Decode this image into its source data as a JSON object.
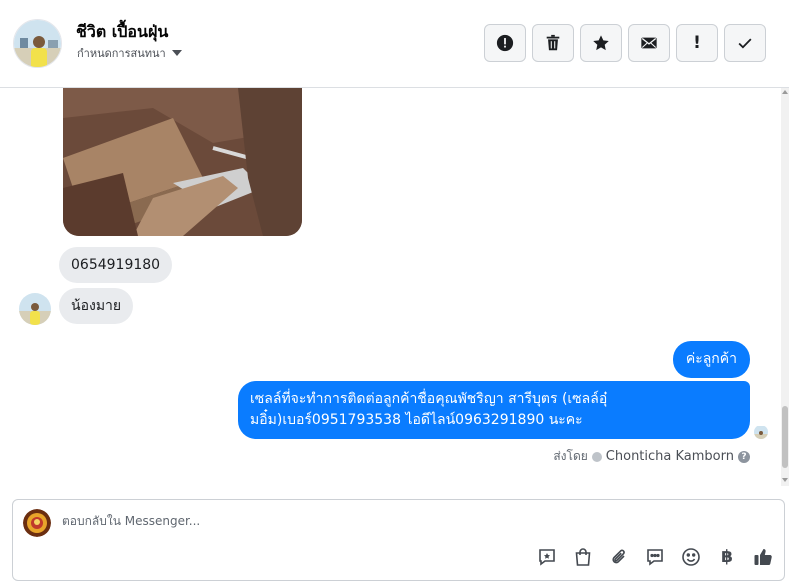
{
  "header": {
    "name": "ชีวิต เปื้อนฝุ่น",
    "assign_label": "กำหนดการสนทนา",
    "actions": [
      {
        "icon": "alert-circle-icon"
      },
      {
        "icon": "trash-icon"
      },
      {
        "icon": "star-icon"
      },
      {
        "icon": "envelope-icon"
      },
      {
        "icon": "exclamation-icon",
        "glyph": "!"
      },
      {
        "icon": "checkmark-icon"
      }
    ]
  },
  "messages": {
    "incoming": [
      {
        "text": "0654919180"
      },
      {
        "text": "น้องมาย"
      }
    ],
    "outgoing": [
      {
        "text": "ค่ะลูกค้า"
      },
      {
        "text": "เซลล์ที่จะทำการติดต่อลูกค้าชื่อคุณพัชริญา สารีบุตร (เซลล์อุ๋มอิ๋ม)เบอร์0951793538 ไอดีไลน์0963291890 นะคะ"
      }
    ],
    "sent_by_label": "ส่งโดย",
    "sent_by_name": "Chonticha Kamborn"
  },
  "composer": {
    "placeholder": "ตอบกลับใน Messenger...",
    "value": "",
    "baht_glyph": "฿"
  },
  "colors": {
    "outgoing_bubble": "#0a7cff",
    "incoming_bubble": "#e9ebee"
  }
}
